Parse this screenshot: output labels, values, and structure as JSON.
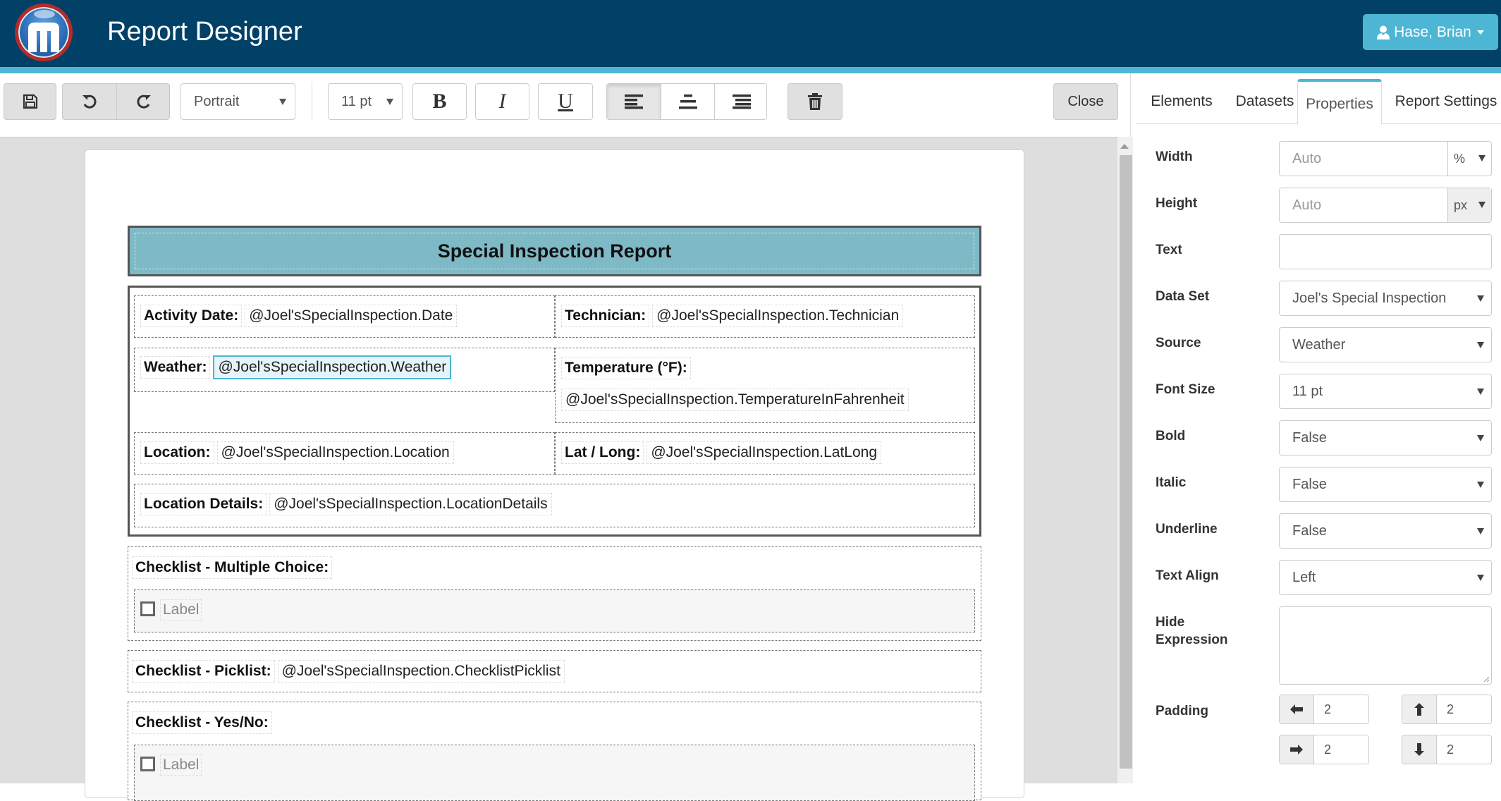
{
  "header": {
    "app_title": "Report Designer",
    "user_name": "Hase, Brian",
    "colors": {
      "header_bg": "#014168",
      "accent": "#4DB6D4",
      "logo_ring": "#b52a2a"
    }
  },
  "toolbar": {
    "orientation": "Portrait",
    "font_size": "11 pt",
    "bold_label": "B",
    "italic_label": "I",
    "underline_label": "U",
    "close_label": "Close",
    "active_alignment": "left",
    "icons": [
      "save-icon",
      "undo-icon",
      "redo-icon",
      "align-left-icon",
      "align-center-icon",
      "align-right-icon",
      "trash-icon"
    ]
  },
  "tabs": [
    {
      "label": "Elements",
      "active": false
    },
    {
      "label": "Datasets",
      "active": false
    },
    {
      "label": "Properties",
      "active": true
    },
    {
      "label": "Report Settings",
      "active": false
    }
  ],
  "properties": {
    "width": {
      "label": "Width",
      "placeholder": "Auto",
      "unit": "%"
    },
    "height": {
      "label": "Height",
      "placeholder": "Auto",
      "unit": "px"
    },
    "text": {
      "label": "Text",
      "value": ""
    },
    "data_set": {
      "label": "Data Set",
      "value": "Joel's Special Inspection"
    },
    "source": {
      "label": "Source",
      "value": "Weather"
    },
    "font_size": {
      "label": "Font Size",
      "value": "11 pt"
    },
    "bold": {
      "label": "Bold",
      "value": "False"
    },
    "italic": {
      "label": "Italic",
      "value": "False"
    },
    "underline": {
      "label": "Underline",
      "value": "False"
    },
    "text_align": {
      "label": "Text Align",
      "value": "Left"
    },
    "hide_expression": {
      "label_line1": "Hide",
      "label_line2": "Expression",
      "value": ""
    },
    "padding": {
      "label": "Padding",
      "left": "2",
      "top": "2",
      "right": "2",
      "bottom": "2"
    }
  },
  "report": {
    "title": "Special Inspection Report",
    "fields": {
      "activity_date": {
        "label": "Activity Date:",
        "value": "@Joel'sSpecialInspection.Date"
      },
      "technician": {
        "label": "Technician:",
        "value": "@Joel'sSpecialInspection.Technician"
      },
      "weather": {
        "label": "Weather:",
        "value": "@Joel'sSpecialInspection.Weather"
      },
      "temperature": {
        "label": "Temperature (°F):",
        "value": "@Joel'sSpecialInspection.TemperatureInFahrenheit"
      },
      "location": {
        "label": "Location:",
        "value": "@Joel'sSpecialInspection.Location"
      },
      "lat_long": {
        "label": "Lat / Long:",
        "value": "@Joel'sSpecialInspection.LatLong"
      },
      "location_details": {
        "label": "Location Details:",
        "value": "@Joel'sSpecialInspection.LocationDetails"
      }
    },
    "checklist_multiple": {
      "label": "Checklist - Multiple Choice:",
      "item_label": "Label"
    },
    "checklist_picklist": {
      "label": "Checklist - Picklist:",
      "value": "@Joel'sSpecialInspection.ChecklistPicklist"
    },
    "checklist_yesno": {
      "label": "Checklist - Yes/No:",
      "item_label": "Label"
    }
  }
}
